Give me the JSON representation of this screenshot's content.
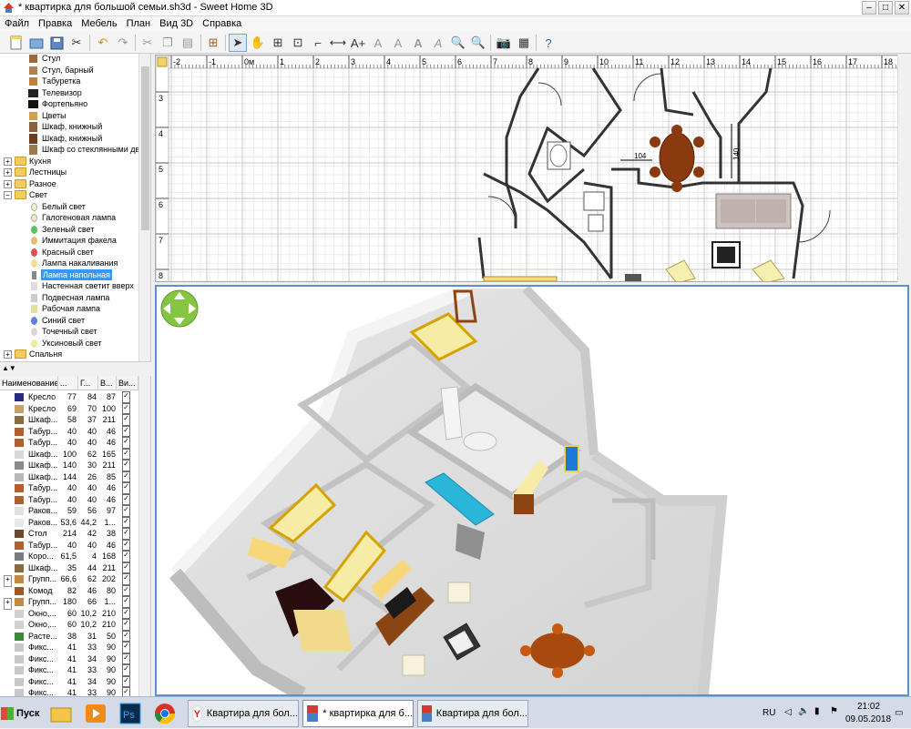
{
  "window": {
    "title": "* квартирка для большой семьи.sh3d - Sweet Home 3D"
  },
  "menu": [
    "Файл",
    "Правка",
    "Мебель",
    "План",
    "Вид 3D",
    "Справка"
  ],
  "catalog": {
    "items": [
      {
        "label": "Стул",
        "type": "item"
      },
      {
        "label": "Стул, барный",
        "type": "item"
      },
      {
        "label": "Табуретка",
        "type": "item"
      },
      {
        "label": "Телевизор",
        "type": "item"
      },
      {
        "label": "Фортепьяно",
        "type": "item"
      },
      {
        "label": "Цветы",
        "type": "item"
      },
      {
        "label": "Шкаф, книжный",
        "type": "item"
      },
      {
        "label": "Шкаф, книжный",
        "type": "item"
      },
      {
        "label": "Шкаф со стеклянными две",
        "type": "item"
      },
      {
        "label": "Кухня",
        "type": "folder",
        "state": "+"
      },
      {
        "label": "Лестницы",
        "type": "folder",
        "state": "+"
      },
      {
        "label": "Разное",
        "type": "folder",
        "state": "+"
      },
      {
        "label": "Свет",
        "type": "folder",
        "state": "-"
      },
      {
        "label": "Белый свет",
        "type": "item"
      },
      {
        "label": "Галогеновая лампа",
        "type": "item"
      },
      {
        "label": "Зеленый свет",
        "type": "item"
      },
      {
        "label": "Иммитация факела",
        "type": "item"
      },
      {
        "label": "Красный свет",
        "type": "item"
      },
      {
        "label": "Лампа накаливания",
        "type": "item"
      },
      {
        "label": "Лампа напольная",
        "type": "item",
        "selected": true
      },
      {
        "label": "Настенная светит вверх",
        "type": "item"
      },
      {
        "label": "Подвесная лампа",
        "type": "item"
      },
      {
        "label": "Рабочая лампа",
        "type": "item"
      },
      {
        "label": "Синий свет",
        "type": "item"
      },
      {
        "label": "Точечный свет",
        "type": "item"
      },
      {
        "label": "Уксиновый свет",
        "type": "item"
      },
      {
        "label": "Спальня",
        "type": "folder",
        "state": "+"
      }
    ]
  },
  "furniture_table": {
    "columns": [
      "Наименование",
      "...",
      "Г...",
      "В...",
      "Ви..."
    ],
    "rows": [
      {
        "name": "Кресло",
        "w": "77",
        "d": "84",
        "h": "87",
        "color": "#2a2a7a",
        "group": false
      },
      {
        "name": "Кресло",
        "w": "69",
        "d": "70",
        "h": "100",
        "color": "#c4a06a",
        "group": false
      },
      {
        "name": "Шкаф...",
        "w": "58",
        "d": "37",
        "h": "211",
        "color": "#8a6a40",
        "group": false
      },
      {
        "name": "Табур...",
        "w": "40",
        "d": "40",
        "h": "46",
        "color": "#b06030",
        "group": false
      },
      {
        "name": "Табур...",
        "w": "40",
        "d": "40",
        "h": "46",
        "color": "#b06030",
        "group": false
      },
      {
        "name": "Шкаф...",
        "w": "100",
        "d": "62",
        "h": "165",
        "color": "#d8d8d8",
        "group": false
      },
      {
        "name": "Шкаф...",
        "w": "140",
        "d": "30",
        "h": "211",
        "color": "#8a8a8a",
        "group": false
      },
      {
        "name": "Шкаф...",
        "w": "144",
        "d": "26",
        "h": "85",
        "color": "#b8b8b8",
        "group": false
      },
      {
        "name": "Табур...",
        "w": "40",
        "d": "40",
        "h": "46",
        "color": "#b06030",
        "group": false
      },
      {
        "name": "Табур...",
        "w": "40",
        "d": "40",
        "h": "46",
        "color": "#b06030",
        "group": false
      },
      {
        "name": "Раков...",
        "w": "59",
        "d": "56",
        "h": "97",
        "color": "#e0e0e0",
        "group": false
      },
      {
        "name": "Раков...",
        "w": "53,6",
        "d": "44,2",
        "h": "1...",
        "color": "#e8e8e8",
        "group": false
      },
      {
        "name": "Стол",
        "w": "214",
        "d": "42",
        "h": "38",
        "color": "#6a4a2a",
        "group": false
      },
      {
        "name": "Табур...",
        "w": "40",
        "d": "40",
        "h": "46",
        "color": "#b06030",
        "group": false
      },
      {
        "name": "Коро...",
        "w": "61,5",
        "d": "4",
        "h": "168",
        "color": "#7a7a7a",
        "group": false
      },
      {
        "name": "Шкаф...",
        "w": "35",
        "d": "44",
        "h": "211",
        "color": "#8a6a40",
        "group": false
      },
      {
        "name": "Групп...",
        "w": "66,6",
        "d": "62",
        "h": "202",
        "color": "#c08a40",
        "group": true
      },
      {
        "name": "Комод",
        "w": "82",
        "d": "46",
        "h": "80",
        "color": "#9a5a2a",
        "group": false
      },
      {
        "name": "Групп...",
        "w": "180",
        "d": "66",
        "h": "1...",
        "color": "#c08a40",
        "group": true
      },
      {
        "name": "Окно,...",
        "w": "60",
        "d": "10,2",
        "h": "210",
        "color": "#d0d0d0",
        "group": false
      },
      {
        "name": "Окно,...",
        "w": "60",
        "d": "10,2",
        "h": "210",
        "color": "#d0d0d0",
        "group": false
      },
      {
        "name": "Расте...",
        "w": "38",
        "d": "31",
        "h": "50",
        "color": "#3a8a3a",
        "group": false
      },
      {
        "name": "Фикс...",
        "w": "41",
        "d": "33",
        "h": "90",
        "color": "#c8c8c8",
        "group": false
      },
      {
        "name": "Фикс...",
        "w": "41",
        "d": "34",
        "h": "90",
        "color": "#c8c8c8",
        "group": false
      },
      {
        "name": "Фикс...",
        "w": "41",
        "d": "33",
        "h": "90",
        "color": "#c8c8c8",
        "group": false
      },
      {
        "name": "Фикс...",
        "w": "41",
        "d": "34",
        "h": "90",
        "color": "#c8c8c8",
        "group": false
      },
      {
        "name": "Фикс...",
        "w": "41",
        "d": "33",
        "h": "90",
        "color": "#c8c8c8",
        "group": false
      }
    ]
  },
  "plan": {
    "ruler_x": [
      "-2",
      "-1",
      "0м",
      "1",
      "2",
      "3",
      "4",
      "5",
      "6",
      "7",
      "8",
      "9",
      "10",
      "11",
      "12",
      "13",
      "14",
      "15",
      "16",
      "17",
      "18"
    ],
    "ruler_y": [
      "3",
      "4",
      "5",
      "6",
      "7",
      "8"
    ],
    "dim_labels": [
      "104",
      "140"
    ]
  },
  "taskbar": {
    "start_label": "Пуск",
    "windows": [
      "Квартира для бол...",
      "* квартирка для б...",
      "Квартира для бол..."
    ],
    "lang": "RU",
    "time": "21:02",
    "date": "09.05.2018"
  },
  "colors": {
    "accent": "#3399ff",
    "selection": "#3399ff",
    "view_border": "#5a8fd0",
    "wood": "#8b4513",
    "bed": "#f7eca6",
    "pool": "#29b6d8"
  }
}
